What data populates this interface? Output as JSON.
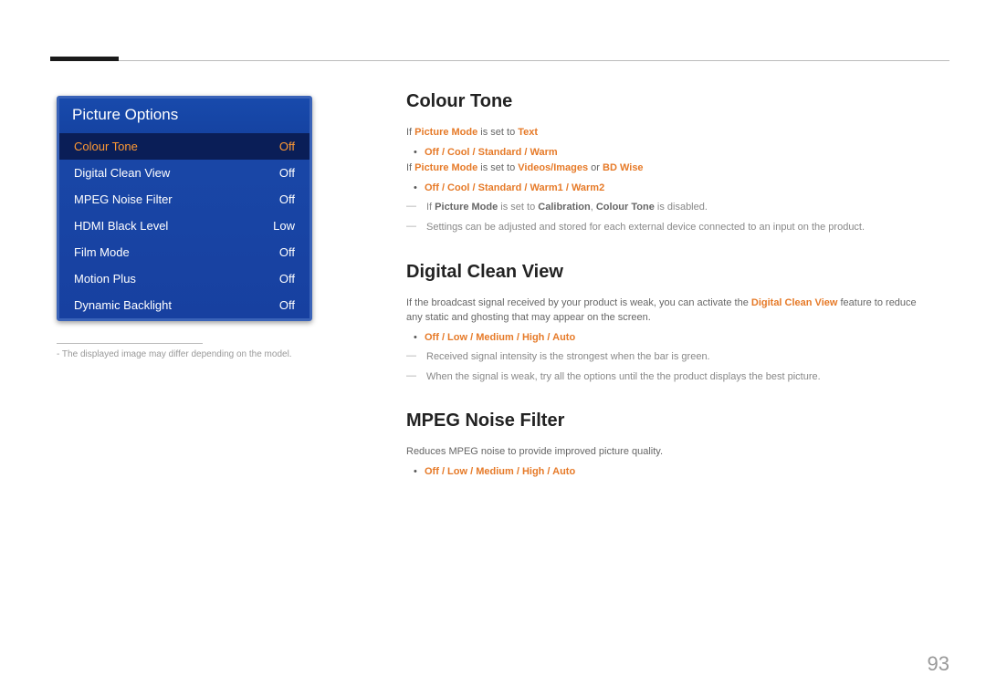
{
  "menu": {
    "title": "Picture Options",
    "items": [
      {
        "label": "Colour Tone",
        "value": "Off"
      },
      {
        "label": "Digital Clean View",
        "value": "Off"
      },
      {
        "label": "MPEG Noise Filter",
        "value": "Off"
      },
      {
        "label": "HDMI Black Level",
        "value": "Low"
      },
      {
        "label": "Film Mode",
        "value": "Off"
      },
      {
        "label": "Motion Plus",
        "value": "Off"
      },
      {
        "label": "Dynamic Backlight",
        "value": "Off"
      }
    ],
    "footnote": "- The displayed image may differ depending on the model."
  },
  "sections": {
    "colourTone": {
      "title": "Colour Tone",
      "line1_a": "If ",
      "line1_b": "Picture Mode",
      "line1_c": " is set to ",
      "line1_d": "Text",
      "bullet1": "Off / Cool / Standard / Warm",
      "line2_a": "If ",
      "line2_b": "Picture Mode",
      "line2_c": " is set to ",
      "line2_d": "Videos/Images",
      "line2_e": " or ",
      "line2_f": "BD Wise",
      "bullet2": "Off / Cool / Standard / Warm1 / Warm2",
      "note1_a": "If ",
      "note1_b": "Picture Mode",
      "note1_c": " is set to ",
      "note1_d": "Calibration",
      "note1_e": ", ",
      "note1_f": "Colour Tone",
      "note1_g": " is disabled.",
      "note2": "Settings can be adjusted and stored for each external device connected to an input on the product."
    },
    "dcv": {
      "title": "Digital Clean View",
      "para_a": "If the broadcast signal received by your product is weak, you can activate the ",
      "para_b": "Digital Clean View",
      "para_c": " feature to reduce any static and ghosting that may appear on the screen.",
      "bullet": "Off / Low / Medium / High / Auto",
      "note1": "Received signal intensity is the strongest when the bar is green.",
      "note2": "When the signal is weak, try all the options until the the product displays the best picture."
    },
    "mpeg": {
      "title": "MPEG Noise Filter",
      "para": "Reduces MPEG noise to provide improved picture quality.",
      "bullet": "Off / Low / Medium / High / Auto"
    }
  },
  "pageNumber": "93"
}
